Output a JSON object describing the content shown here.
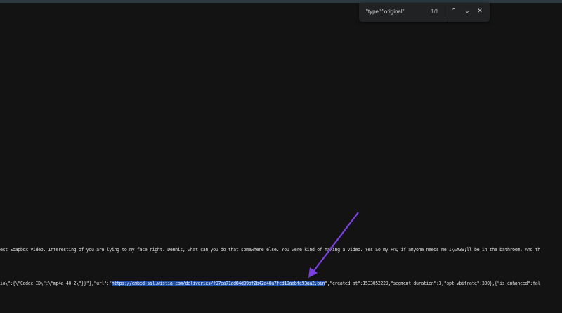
{
  "find_bar": {
    "query": "\"type\":\"original\"",
    "count": "1/1",
    "prev_icon": "chevron-up-icon",
    "next_icon": "chevron-down-icon",
    "close_icon": "close-icon"
  },
  "content": {
    "line1": "est Soapbox video. Interesting of you are lying to my face right. Dennis, what can you do that somewhere else. You were kind of making a video. Yes So my FAQ if anyone needs me I\\&#39;ll be in the bathroom. And th",
    "line2_pre": "io\\\":{\\\"Codec ID\\\":\\\"mp4a-40-2\\\"}}\"},\"url\":\"",
    "line2_highlight": "https://embed-ssl.wistia.com/deliveries/f97ea71ad84d39bf2b42e40a7fcd19aabfe93aa2.bin",
    "line2_post": "\",\"created_at\":1533052229,\"segment_duration\":3,\"opt_vbitrate\":300},{\"is_enhanced\":fal"
  },
  "annotation": {
    "color": "#7b3fe4"
  }
}
